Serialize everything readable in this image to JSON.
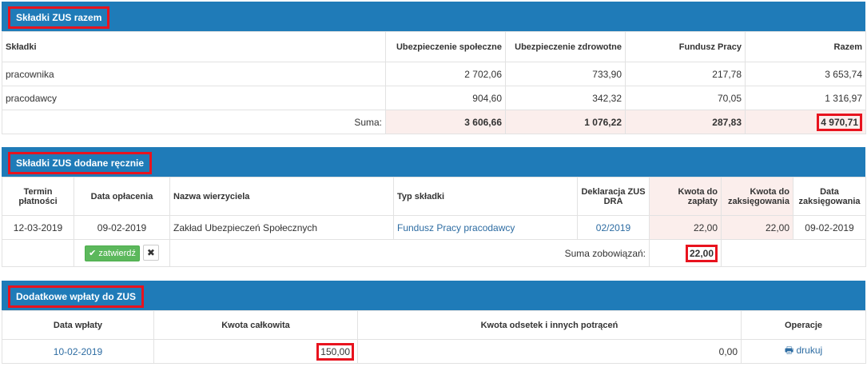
{
  "sec1": {
    "title": "Składki ZUS razem",
    "headers": [
      "Składki",
      "Ubezpieczenie społeczne",
      "Ubezpieczenie zdrowotne",
      "Fundusz Pracy",
      "Razem"
    ],
    "rows": [
      [
        "pracownika",
        "2 702,06",
        "733,90",
        "217,78",
        "3 653,74"
      ],
      [
        "pracodawcy",
        "904,60",
        "342,32",
        "70,05",
        "1 316,97"
      ]
    ],
    "sum_label": "Suma:",
    "sum": [
      "3 606,66",
      "1 076,22",
      "287,83",
      "4 970,71"
    ]
  },
  "sec2": {
    "title": "Składki ZUS dodane ręcznie",
    "headers": [
      "Termin płatności",
      "Data opłacenia",
      "Nazwa wierzyciela",
      "Typ składki",
      "Deklaracja ZUS DRA",
      "Kwota do zapłaty",
      "Kwota do zaksięgowania",
      "Data zaksięgowania"
    ],
    "row": [
      "12-03-2019",
      "09-02-2019",
      "Zakład Ubezpieczeń Społecznych",
      "Fundusz Pracy pracodawcy",
      "02/2019",
      "22,00",
      "22,00",
      "09-02-2019"
    ],
    "confirm_label": "zatwierdź",
    "confirm_icon": "check-icon",
    "delete_label": "✖",
    "sum_label": "Suma zobowiązań:",
    "sum_value": "22,00"
  },
  "sec3": {
    "title": "Dodatkowe wpłaty do ZUS",
    "headers": [
      "Data wpłaty",
      "Kwota całkowita",
      "Kwota odsetek i innych potrąceń",
      "Operacje"
    ],
    "row": [
      "10-02-2019",
      "150,00",
      "0,00"
    ],
    "print_label": "drukuj",
    "print_icon": "printer-icon"
  },
  "colors": {
    "header_bar": "#1f7bb8",
    "highlight_border": "#e8131e",
    "sum_bg": "#fbeeec",
    "link": "#2d6ca2",
    "confirm_button": "#5cb85c"
  }
}
